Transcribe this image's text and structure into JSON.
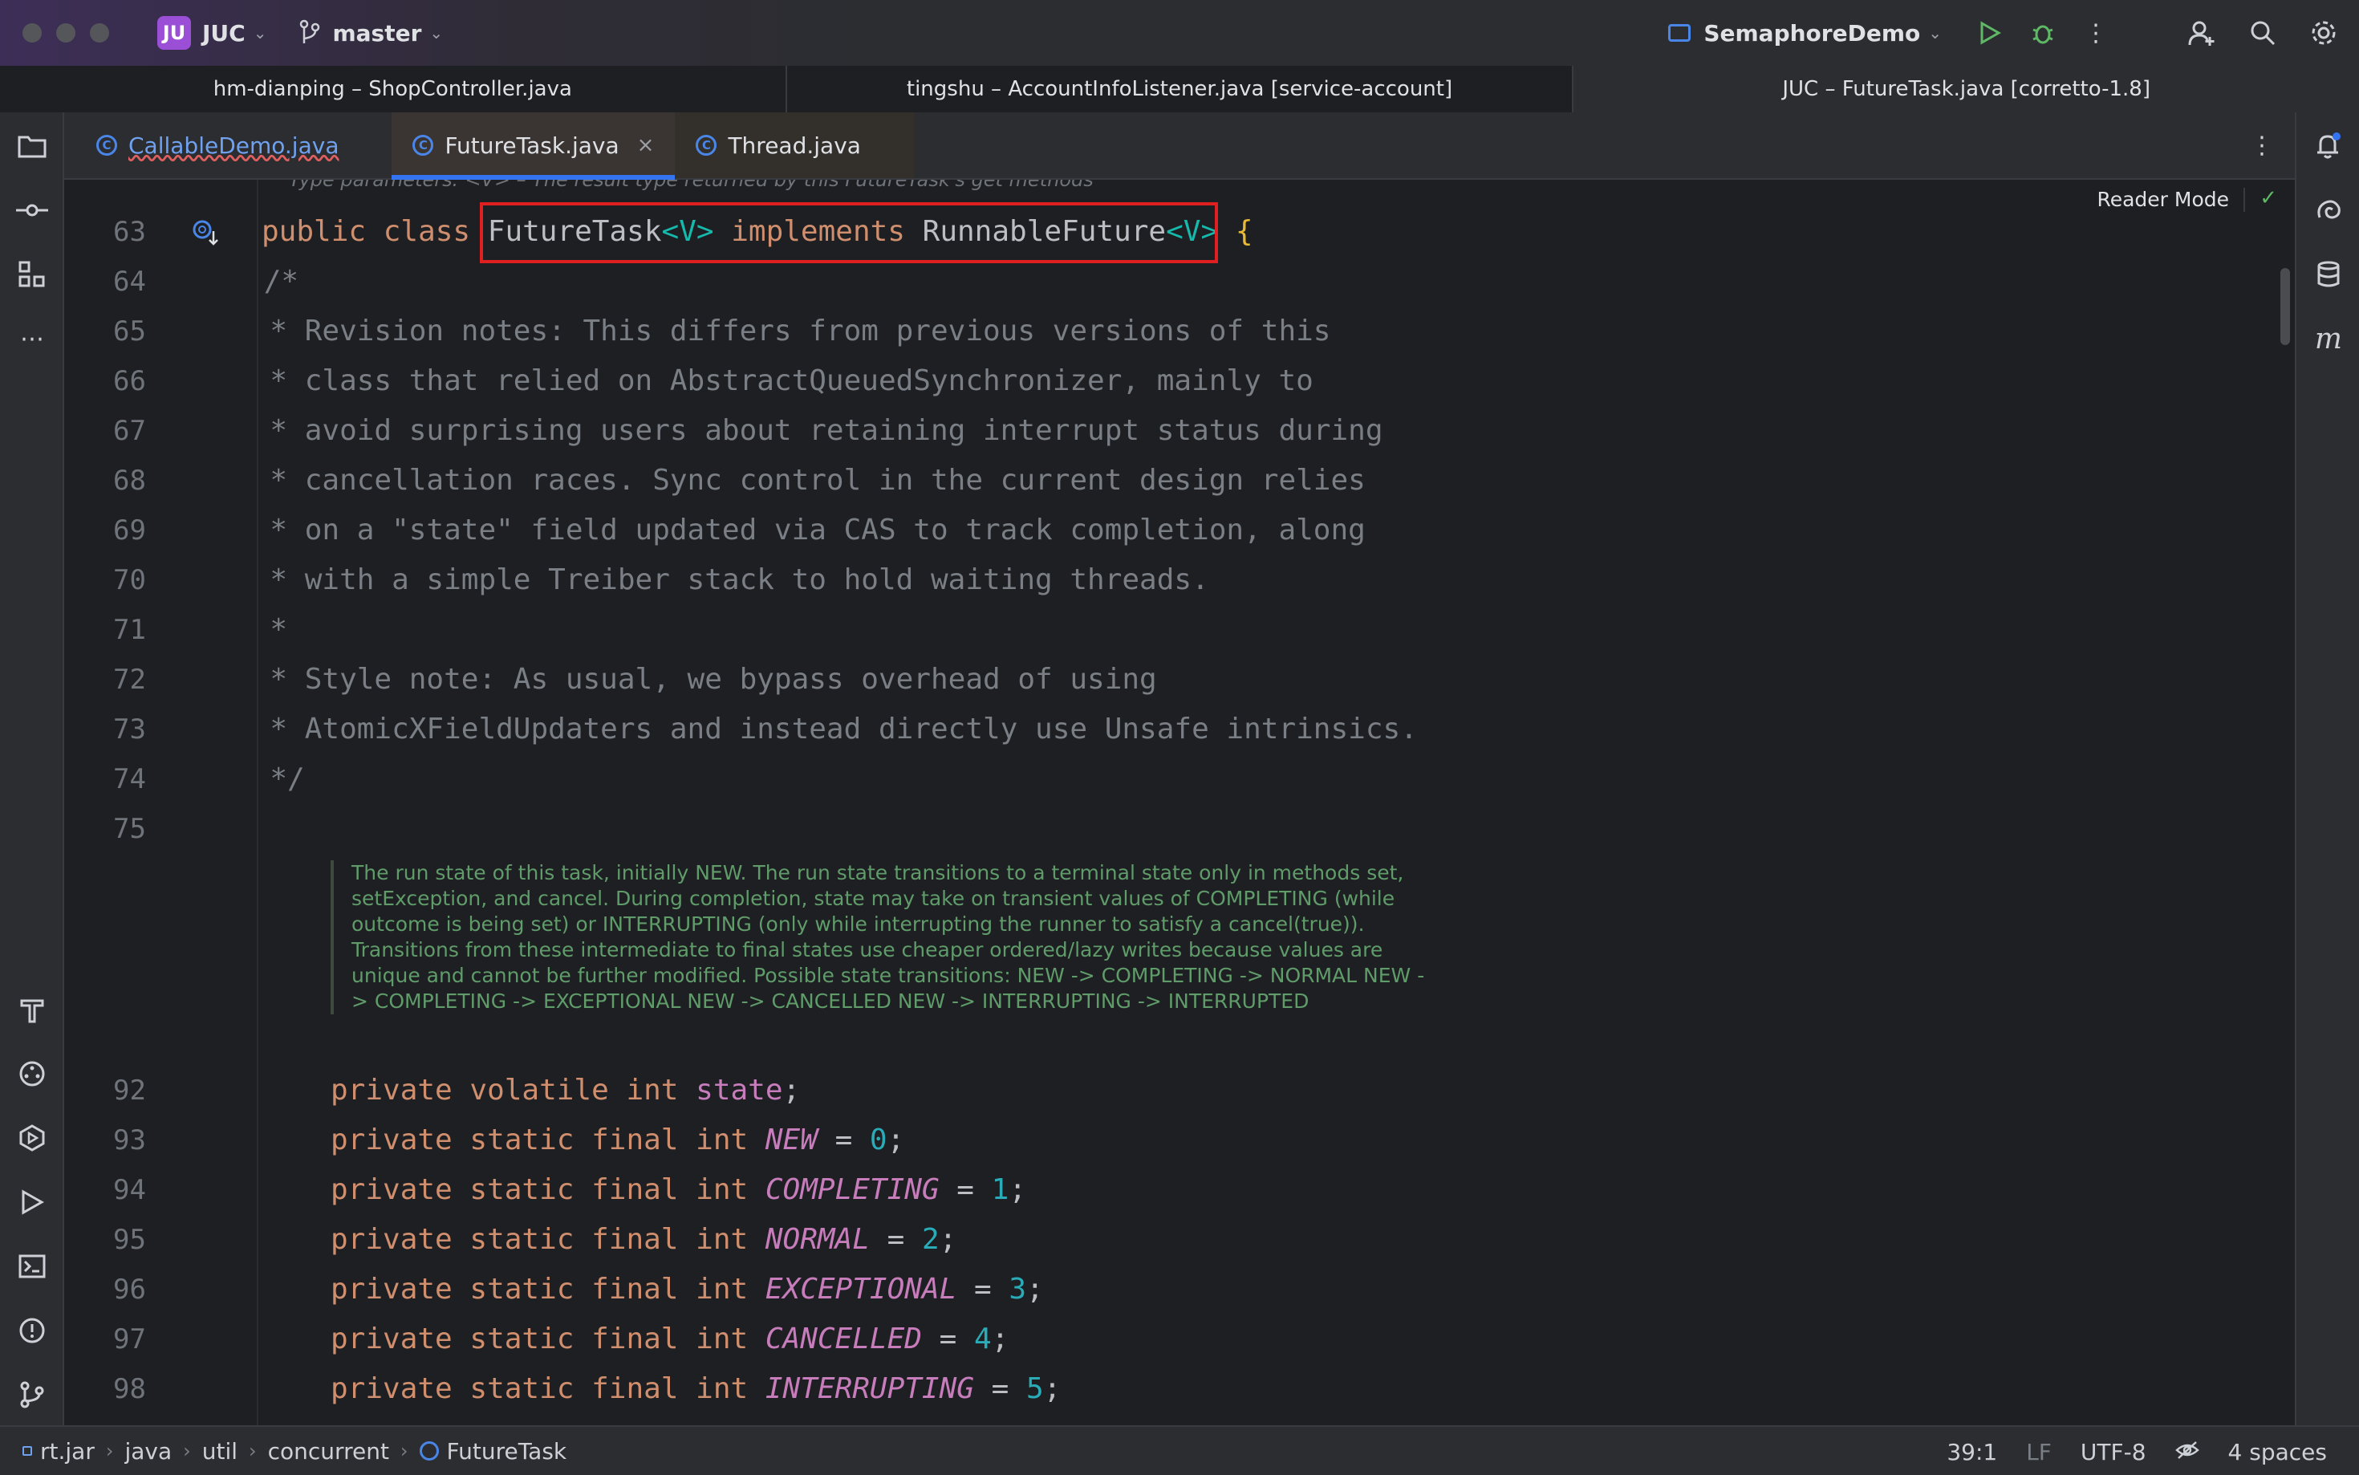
{
  "titlebar": {
    "project_badge": "JU",
    "project_name": "JUC",
    "branch": "master",
    "run_config": "SemaphoreDemo",
    "icons": [
      "run-icon",
      "debug-icon",
      "more-icon",
      "add-user-icon",
      "search-icon",
      "settings-icon"
    ]
  },
  "project_tabs": [
    {
      "label": "hm-dianping – ShopController.java",
      "active": false
    },
    {
      "label": "tingshu – AccountInfoListener.java [service-account]",
      "active": false
    },
    {
      "label": "JUC – FutureTask.java [corretto-1.8]",
      "active": true
    }
  ],
  "editor_tabs": [
    {
      "label": "CallableDemo.java",
      "active": false
    },
    {
      "label": "FutureTask.java",
      "active": true,
      "close": "×"
    },
    {
      "label": "Thread.java",
      "active": false
    }
  ],
  "editor": {
    "reader_mode": "Reader Mode",
    "cut_doc": "Type parameters: <V> – The result type returned by this FutureTask's get methods",
    "lines": [
      {
        "n": "63",
        "code": "public class FutureTask<V> implements RunnableFuture<V> {"
      },
      {
        "n": "64",
        "code": "    /*"
      },
      {
        "n": "65",
        "code": "     * Revision notes: This differs from previous versions of this"
      },
      {
        "n": "66",
        "code": "     * class that relied on AbstractQueuedSynchronizer, mainly to"
      },
      {
        "n": "67",
        "code": "     * avoid surprising users about retaining interrupt status during"
      },
      {
        "n": "68",
        "code": "     * cancellation races. Sync control in the current design relies"
      },
      {
        "n": "69",
        "code": "     * on a \"state\" field updated via CAS to track completion, along"
      },
      {
        "n": "70",
        "code": "     * with a simple Treiber stack to hold waiting threads."
      },
      {
        "n": "71",
        "code": "     *"
      },
      {
        "n": "72",
        "code": "     * Style note: As usual, we bypass overhead of using"
      },
      {
        "n": "73",
        "code": "     * AtomicXFieldUpdaters and instead directly use Unsafe intrinsics."
      },
      {
        "n": "74",
        "code": "     */"
      },
      {
        "n": "75",
        "code": ""
      }
    ],
    "doc_text": "The run state of this task, initially NEW. The run state transitions to a terminal state only in methods set, setException, and cancel. During completion, state may take on transient values of COMPLETING (while outcome is being set) or INTERRUPTING (only while interrupting the runner to satisfy a cancel(true)). Transitions from these intermediate to final states use cheaper ordered/lazy writes because values are unique and cannot be further modified. Possible state transitions: NEW -> COMPLETING -> NORMAL NEW -> COMPLETING -> EXCEPTIONAL NEW -> CANCELLED NEW -> INTERRUPTING -> INTERRUPTED",
    "fields": [
      {
        "n": "92",
        "prefix": "private volatile int ",
        "name": "state",
        "value": ""
      },
      {
        "n": "93",
        "prefix": "private static final int ",
        "name": "NEW",
        "value": "0"
      },
      {
        "n": "94",
        "prefix": "private static final int ",
        "name": "COMPLETING",
        "value": "1"
      },
      {
        "n": "95",
        "prefix": "private static final int ",
        "name": "NORMAL",
        "value": "2"
      },
      {
        "n": "96",
        "prefix": "private static final int ",
        "name": "EXCEPTIONAL",
        "value": "3"
      },
      {
        "n": "97",
        "prefix": "private static final int ",
        "name": "CANCELLED",
        "value": "4"
      },
      {
        "n": "98",
        "prefix": "private static final int ",
        "name": "INTERRUPTING",
        "value": "5"
      }
    ]
  },
  "statusbar": {
    "breadcrumbs": [
      "rt.jar",
      "java",
      "util",
      "concurrent",
      "FutureTask"
    ],
    "position": "39:1",
    "line_sep": "LF",
    "encoding": "UTF-8",
    "indent": "4 spaces"
  }
}
